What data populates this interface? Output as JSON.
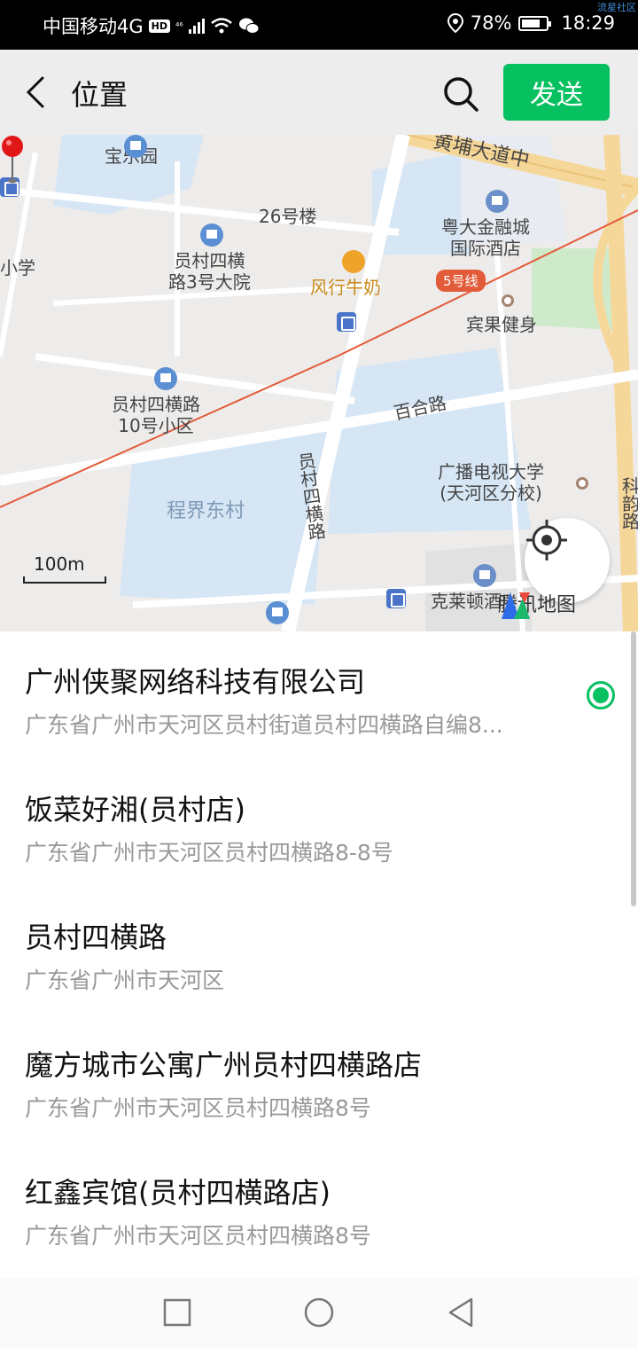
{
  "status_bar": {
    "carrier": "中国移动4G",
    "hd": "HD",
    "network": "⁴⁶",
    "battery_pct": "78%",
    "battery_level": 0.78,
    "time": "18:29",
    "watermark": "流星社区"
  },
  "header": {
    "title": "位置",
    "send_label": "发送"
  },
  "map": {
    "labels": {
      "baoleyuan": "宝乐园",
      "huangpu": "黄埔大道中",
      "b26": "26号楼",
      "jinrong": "粤大金融城\n国际酒店",
      "yuncun3": "员村四横\n路3号大院",
      "milk": "风行牛奶",
      "metro": "5号线",
      "binguo": "宾果健身",
      "xiaoxue": "小学",
      "yuncun10": "员村四横路\n10号小区",
      "baihe": "百合路",
      "guangbo": "广播电视大学\n(天河区分校)",
      "yuncunroad": "员\n村\n四\n横\n路",
      "chengjie": "程界东村",
      "kelai": "克莱顿酒店",
      "right_edge": "科\n韵\n路"
    },
    "scale_label": "100m",
    "brand": "腾讯地图"
  },
  "places": [
    {
      "name": "广州侠聚网络科技有限公司",
      "address": "广东省广州市天河区员村街道员村四横路自编8...",
      "selected": true
    },
    {
      "name": "饭菜好湘(员村店)",
      "address": "广东省广州市天河区员村四横路8-8号",
      "selected": false
    },
    {
      "name": "员村四横路",
      "address": "广东省广州市天河区",
      "selected": false
    },
    {
      "name": "魔方城市公寓广州员村四横路店",
      "address": "广东省广州市天河区员村四横路8号",
      "selected": false
    },
    {
      "name": "红鑫宾馆(员村四横路店)",
      "address": "广东省广州市天河区员村四横路8号",
      "selected": false
    }
  ],
  "colors": {
    "accent": "#07c160",
    "header_bg": "#ededed",
    "map_water": "#d6e6f5",
    "metro_line": "#e25c3a"
  }
}
